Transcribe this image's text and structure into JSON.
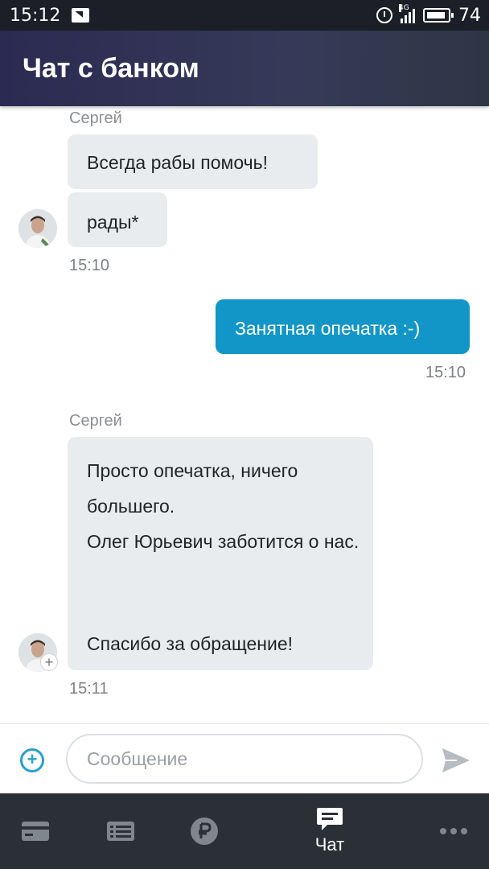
{
  "status_bar": {
    "time": "15:12",
    "network": "4G",
    "battery": "74"
  },
  "app_bar": {
    "title": "Чат с банком"
  },
  "messages": [
    {
      "sender": "Сергей",
      "bubbles": [
        "Всегда рабы помочь!",
        "рады*"
      ],
      "time": "15:10",
      "direction": "in"
    },
    {
      "bubbles": [
        "Занятная опечатка :-)"
      ],
      "time": "15:10",
      "direction": "out"
    },
    {
      "sender": "Сергей",
      "bubbles": [
        "Просто опечатка, ничего большего.",
        "Олег Юрьевич заботится о нас.",
        "Спасибо за обращение!"
      ],
      "time": "15:11",
      "direction": "in"
    }
  ],
  "input": {
    "placeholder": "Сообщение",
    "value": ""
  },
  "bottom_nav": {
    "items": [
      {
        "icon": "card-icon",
        "label": ""
      },
      {
        "icon": "list-icon",
        "label": ""
      },
      {
        "icon": "ruble-icon",
        "label": ""
      },
      {
        "icon": "chat-icon",
        "label": "Чат",
        "active": true
      },
      {
        "icon": "more-icon",
        "label": ""
      }
    ]
  },
  "colors": {
    "accent": "#1296c8",
    "incoming_bubble": "#e9ecee",
    "nav_bg": "#2b3036",
    "nav_icon": "#7f868d"
  }
}
